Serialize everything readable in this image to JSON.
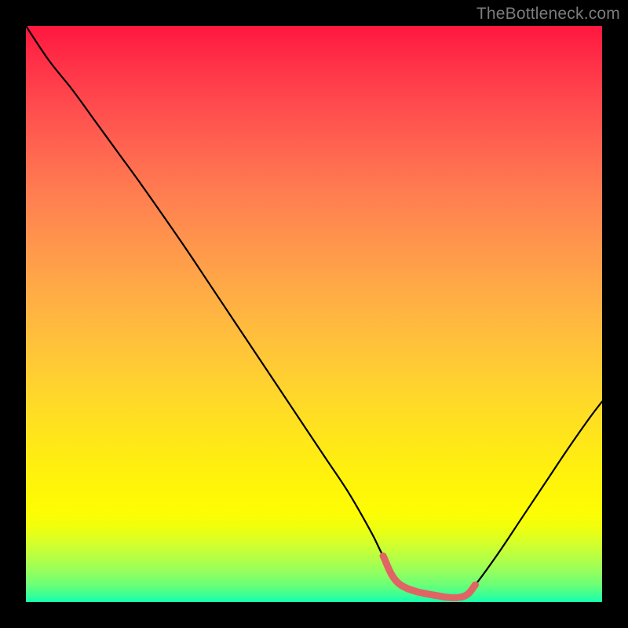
{
  "watermark": "TheBottleneck.com",
  "colors": {
    "background": "#000000",
    "watermark_text": "#7b7b7b",
    "curve_stroke": "#000000",
    "flat_segment_stroke": "#e16464"
  },
  "chart_data": {
    "type": "line",
    "title": "",
    "xlabel": "",
    "ylabel": "",
    "xlim": [
      0,
      100
    ],
    "ylim": [
      0,
      100
    ],
    "grid": false,
    "legend": false,
    "x": [
      0,
      4,
      8,
      12,
      16,
      20,
      24,
      28,
      32,
      36,
      40,
      44,
      48,
      52,
      56,
      60,
      62,
      65,
      72,
      76,
      78,
      82,
      86,
      90,
      94,
      98,
      100
    ],
    "y": [
      100,
      94,
      89,
      83.5,
      78,
      72.5,
      66.8,
      61,
      55,
      49,
      43,
      37,
      31,
      25,
      19,
      12,
      8,
      3,
      1,
      1,
      3,
      8.5,
      14.5,
      20.5,
      26.5,
      32.2,
      34.8
    ],
    "flat_segment": {
      "x": [
        62,
        65,
        72,
        76,
        78
      ],
      "y": [
        8,
        3,
        1,
        1,
        3
      ]
    }
  }
}
